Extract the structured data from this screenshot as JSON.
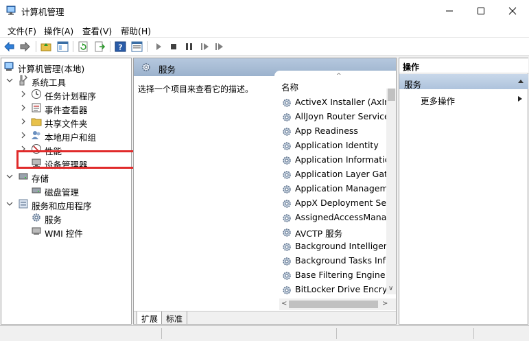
{
  "window": {
    "title": "计算机管理"
  },
  "menu": {
    "items": [
      "文件(F)",
      "操作(A)",
      "查看(V)",
      "帮助(H)"
    ]
  },
  "toolbar": {
    "icons": [
      "back-icon",
      "forward-icon",
      "up-folder-icon",
      "show-hide-tree-icon",
      "refresh-icon",
      "export-list-icon",
      "help-icon",
      "properties-icon",
      "start-service-icon",
      "stop-service-icon",
      "pause-service-icon",
      "restart-service-icon"
    ]
  },
  "tree": {
    "root": "计算机管理(本地)",
    "system_tools": "系统工具",
    "task_scheduler": "任务计划程序",
    "event_viewer": "事件查看器",
    "shared_folders": "共享文件夹",
    "local_users": "本地用户和组",
    "performance": "性能",
    "device_manager": "设备管理器",
    "storage": "存储",
    "disk_management": "磁盘管理",
    "services_apps": "服务和应用程序",
    "services": "服务",
    "wmi": "WMI 控件"
  },
  "center": {
    "header": "服务",
    "description": "选择一个项目来查看它的描述。",
    "column_name": "名称",
    "services": [
      "ActiveX Installer (AxIns",
      "AllJoyn Router Service",
      "App Readiness",
      "Application Identity",
      "Application Informatic",
      "Application Layer Gate",
      "Application Managem",
      "AppX Deployment Ser",
      "AssignedAccessManag",
      "AVCTP 服务",
      "Background Intelligen",
      "Background Tasks Inf",
      "Base Filtering Engine",
      "BitLocker Drive Encryp"
    ],
    "tabs": [
      "扩展",
      "标准"
    ]
  },
  "actions": {
    "title": "操作",
    "section": "服务",
    "more": "更多操作"
  },
  "colors": {
    "header_blue": "#9bb2cd",
    "selection_red": "#e02a2a",
    "section_blue": "#aec3dc"
  }
}
